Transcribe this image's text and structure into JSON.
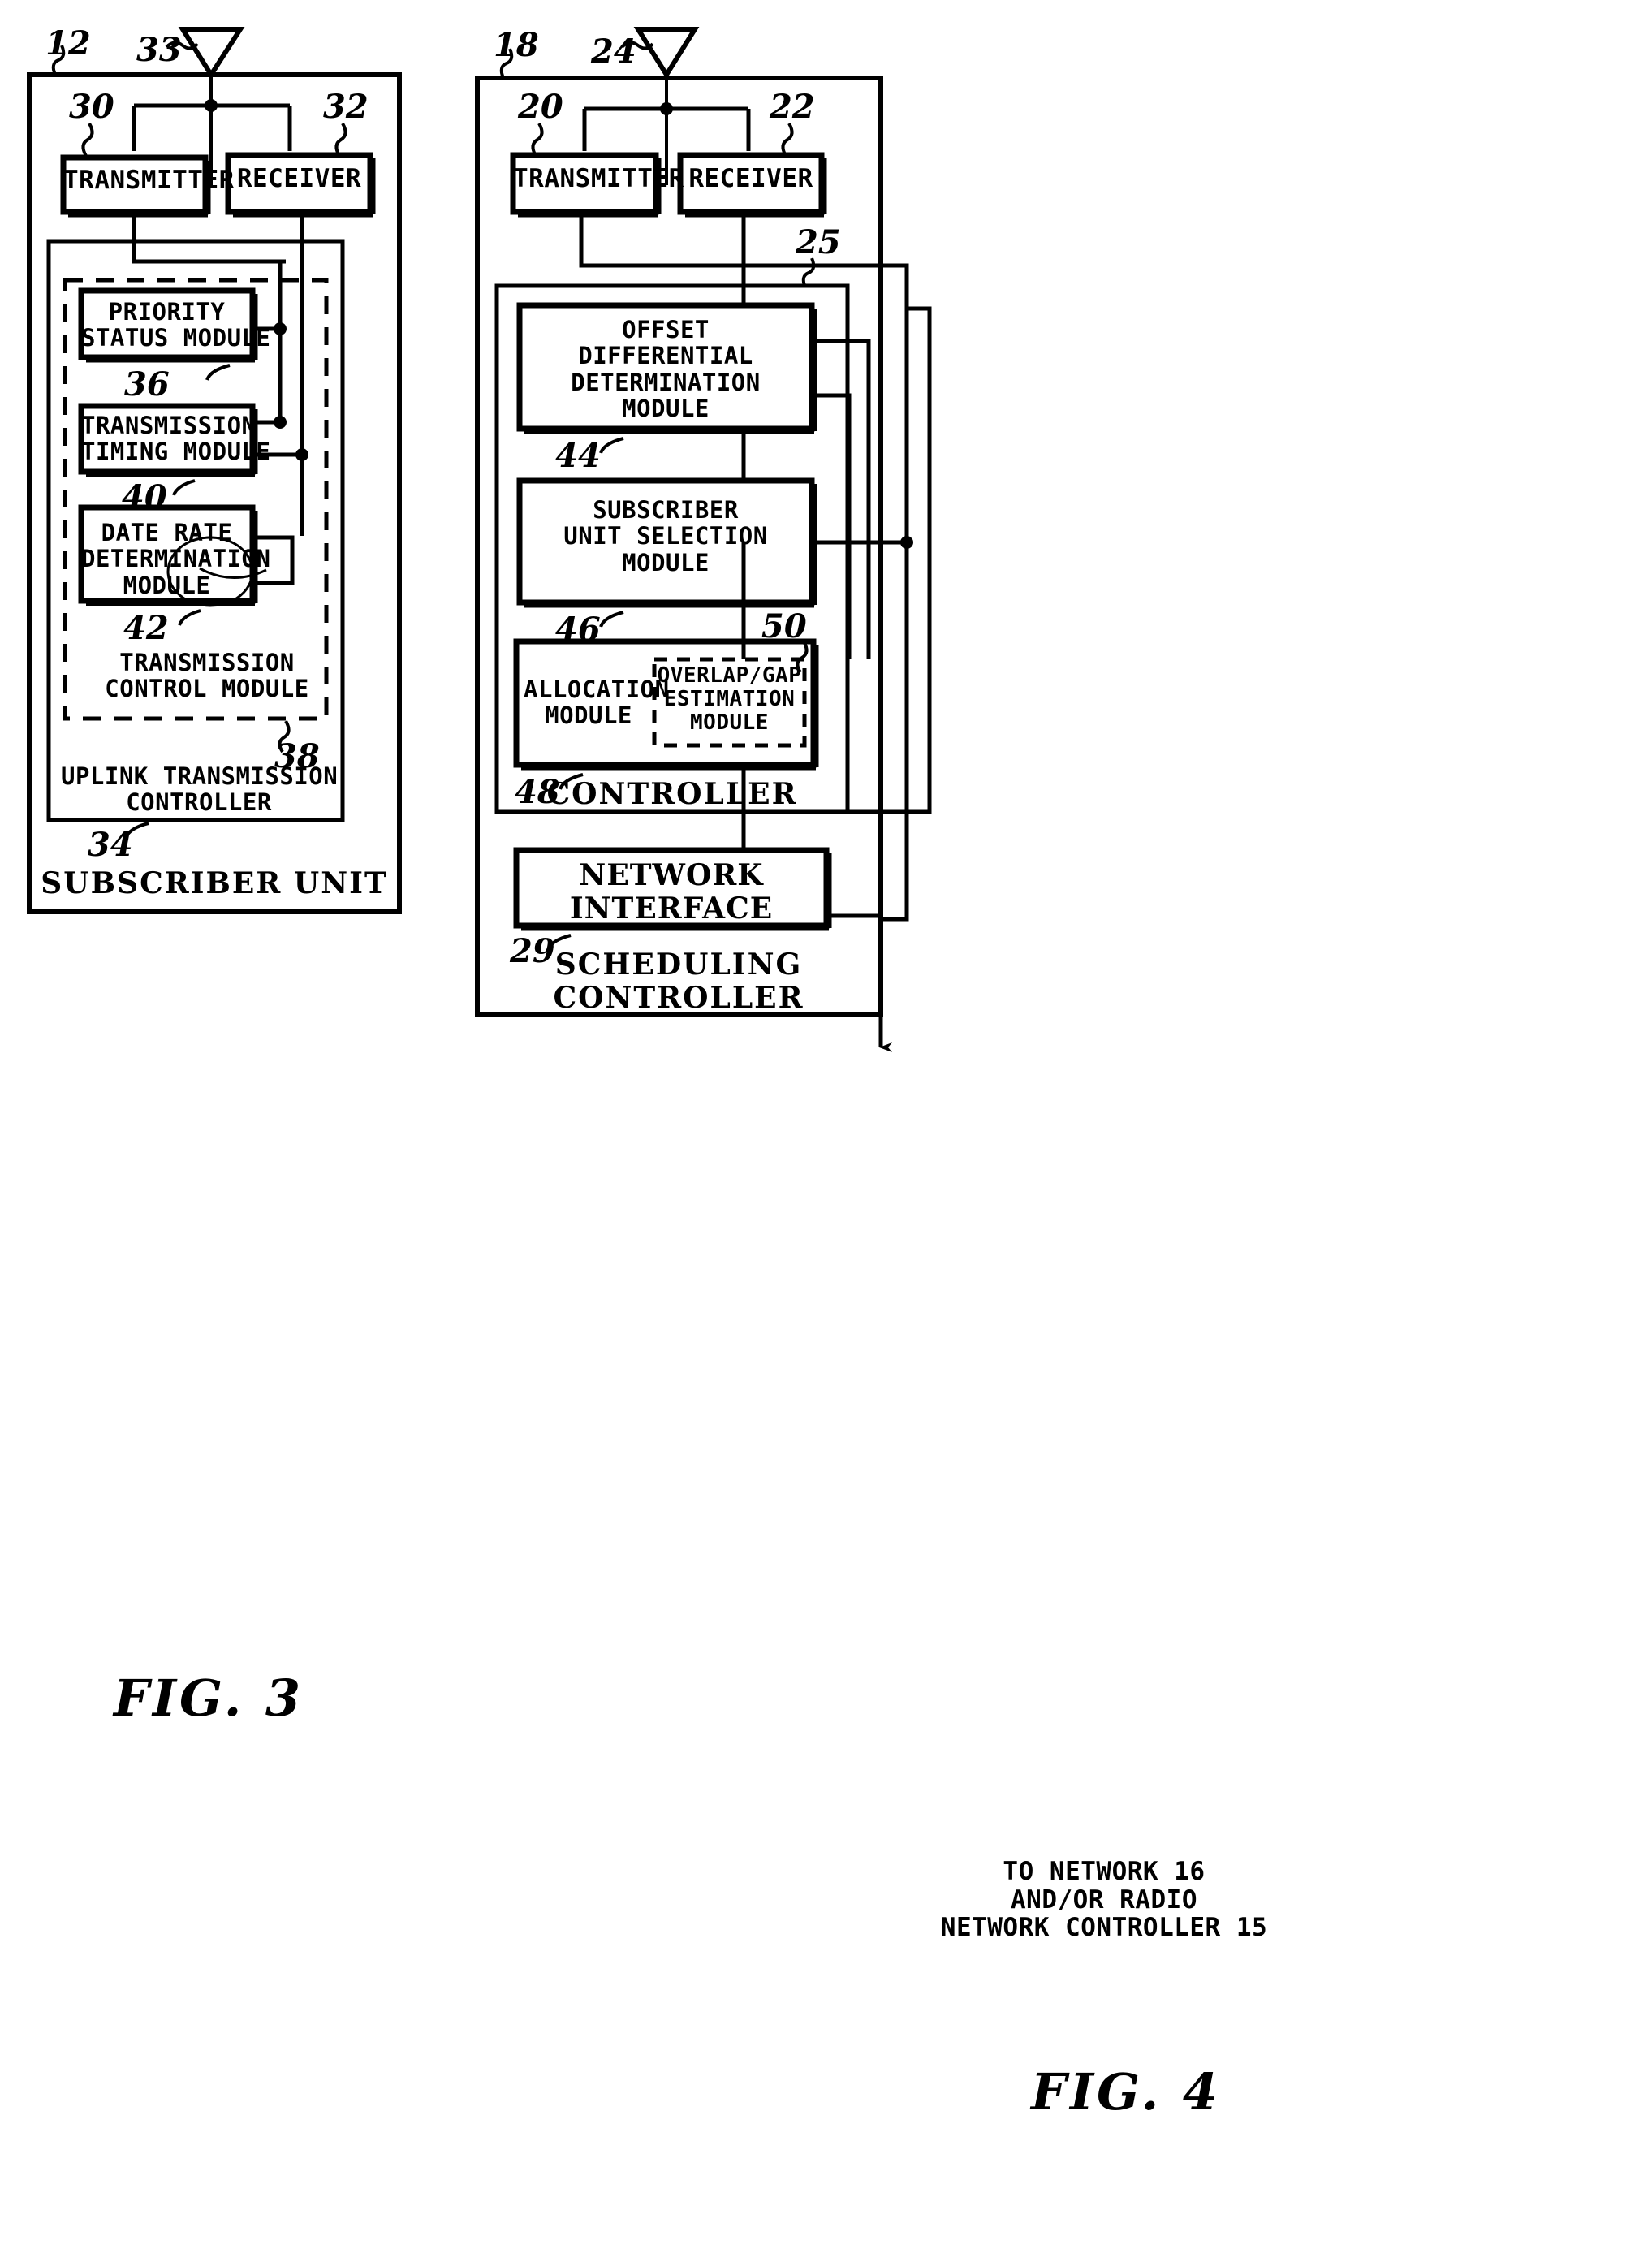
{
  "figures": [
    {
      "id": "fig3",
      "title": "FIG. 3",
      "outer_label": "SUBSCRIBER UNIT",
      "outer_ref": "12",
      "antenna_ref": "33",
      "blocks": {
        "transmitter": {
          "label": "TRANSMITTER",
          "ref": "30"
        },
        "receiver": {
          "label": "RECEIVER",
          "ref": "32"
        },
        "priority_status": {
          "label": "PRIORITY\nSTATUS MODULE",
          "ref": "36"
        },
        "transmission_timing": {
          "label": "TRANSMISSION\nTIMING MODULE",
          "ref": "40"
        },
        "data_rate": {
          "label": "DATE RATE\nDETERMINATION\nMODULE",
          "ref": "42"
        },
        "transmission_control": {
          "label": "TRANSMISSION\nCONTROL MODULE",
          "ref": "38"
        },
        "uplink_controller": {
          "label": "UPLINK TRANSMISSION\nCONTROLLER",
          "ref": "34"
        }
      }
    },
    {
      "id": "fig4",
      "title": "FIG. 4",
      "outer_label": "SCHEDULING\nCONTROLLER",
      "outer_ref": "18",
      "antenna_ref": "24",
      "blocks": {
        "transmitter": {
          "label": "TRANSMITTER",
          "ref": "20"
        },
        "receiver": {
          "label": "RECEIVER",
          "ref": "22"
        },
        "offset_differential": {
          "label": "OFFSET\nDIFFERENTIAL\nDETERMINATION\nMODULE",
          "ref": "44"
        },
        "subscriber_unit_selection": {
          "label": "SUBSCRIBER\nUNIT SELECTION\nMODULE",
          "ref": "46"
        },
        "allocation": {
          "label": "ALLOCATION\nMODULE",
          "ref": "48"
        },
        "overlap_gap": {
          "label": "OVERLAP/GAP\nESTIMATION\nMODULE",
          "ref": "50"
        },
        "controller": {
          "label": "CONTROLLER",
          "ref": "25"
        },
        "network_interface": {
          "label": "NETWORK\nINTERFACE",
          "ref": "29"
        }
      },
      "output_note": "TO NETWORK 16\nAND/OR RADIO\nNETWORK CONTROLLER 15"
    }
  ],
  "colors": {
    "ink": "#000000",
    "paper": "#ffffff"
  }
}
